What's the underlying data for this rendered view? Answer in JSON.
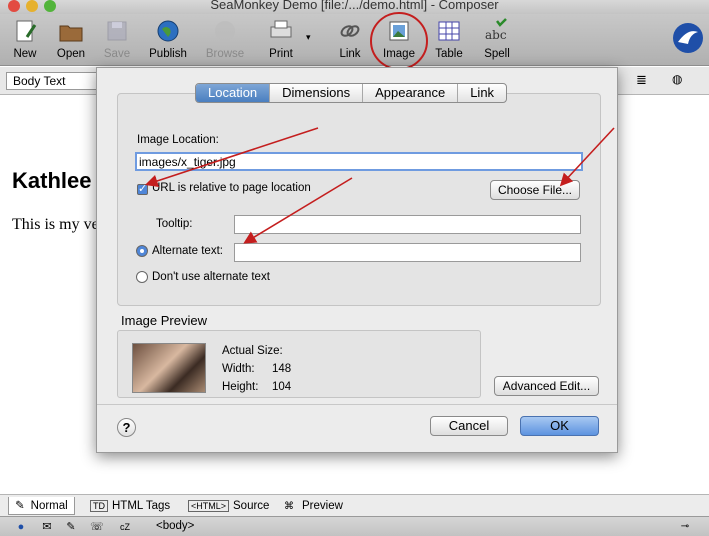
{
  "window": {
    "title": "SeaMonkey Demo [file:/.../demo.html] - Composer"
  },
  "toolbar": {
    "buttons": [
      {
        "label": "New",
        "icon": "new-document-icon",
        "disabled": false
      },
      {
        "label": "Open",
        "icon": "folder-icon",
        "disabled": false
      },
      {
        "label": "Save",
        "icon": "floppy-disk-icon",
        "disabled": true
      },
      {
        "label": "Publish",
        "icon": "globe-icon",
        "disabled": false
      },
      {
        "label": "Browse",
        "icon": "browse-icon",
        "disabled": true
      },
      {
        "label": "Print",
        "icon": "printer-icon",
        "disabled": false
      },
      {
        "label": "Link",
        "icon": "link-icon",
        "disabled": false
      },
      {
        "label": "Image",
        "icon": "image-icon",
        "disabled": false
      },
      {
        "label": "Table",
        "icon": "table-icon",
        "disabled": false
      },
      {
        "label": "Spell",
        "icon": "spell-check-icon",
        "disabled": false
      }
    ]
  },
  "formatbar": {
    "paragraph_format": "Body Text"
  },
  "document": {
    "heading": "Kathlee",
    "paragraph": "This is my ve"
  },
  "dialog": {
    "tabs": [
      "Location",
      "Dimensions",
      "Appearance",
      "Link"
    ],
    "active_tab": "Location",
    "image_location_label": "Image Location:",
    "image_location_value": "images/x_tiger.jpg",
    "relative_url_label": "URL is relative to page location",
    "relative_url_checked": true,
    "choose_file_label": "Choose File...",
    "tooltip_label": "Tooltip:",
    "tooltip_value": "",
    "alt_text_label": "Alternate text:",
    "alt_text_value": "",
    "no_alt_label": "Don't use alternate text",
    "alt_option_selected": "Alternate text:",
    "preview": {
      "section_label": "Image Preview",
      "actual_size_label": "Actual Size:",
      "width_label": "Width:",
      "width_value": "148",
      "height_label": "Height:",
      "height_value": "104"
    },
    "advanced_edit_label": "Advanced Edit...",
    "help_label": "?",
    "cancel_label": "Cancel",
    "ok_label": "OK"
  },
  "modebar": {
    "tabs": [
      {
        "label": "Normal",
        "icon": "pen-icon"
      },
      {
        "label": "HTML Tags",
        "icon": "td-tag-icon",
        "icon_text": "TD"
      },
      {
        "label": "Source",
        "icon": "html-source-icon",
        "icon_text": "<HTML>"
      },
      {
        "label": "Preview",
        "icon": "preview-icon"
      }
    ],
    "active": "Normal"
  },
  "statusbar": {
    "tag": "<body>"
  },
  "colors": {
    "annotation_red": "#c41e1e",
    "accent_blue": "#4f86d8"
  }
}
